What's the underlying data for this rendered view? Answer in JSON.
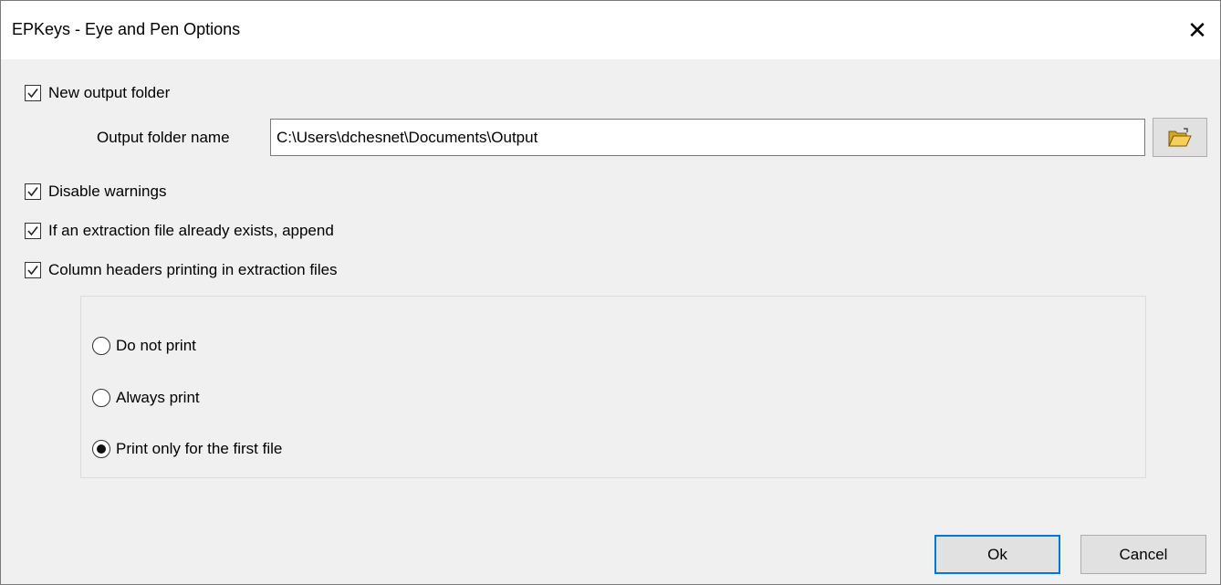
{
  "window": {
    "title": "EPKeys - Eye and Pen Options",
    "close_glyph": "✕"
  },
  "options": {
    "new_output_folder": {
      "label": "New output folder",
      "checked": true
    },
    "output_folder": {
      "label": "Output folder name",
      "value": "C:\\Users\\dchesnet\\Documents\\Output",
      "browse_icon": "folder-open-icon"
    },
    "disable_warnings": {
      "label": "Disable warnings",
      "checked": true
    },
    "append": {
      "label": "If an extraction file already exists, append",
      "checked": true
    },
    "column_headers": {
      "label": "Column headers printing in extraction files",
      "checked": true
    }
  },
  "print_mode": {
    "options": [
      {
        "label": "Do not print",
        "selected": false
      },
      {
        "label": "Always print",
        "selected": false
      },
      {
        "label": "Print only for the first file",
        "selected": true
      }
    ]
  },
  "buttons": {
    "ok": "Ok",
    "cancel": "Cancel"
  },
  "colors": {
    "accent": "#0078d7",
    "background": "#f0f0f0",
    "titlebar": "#ffffff"
  }
}
